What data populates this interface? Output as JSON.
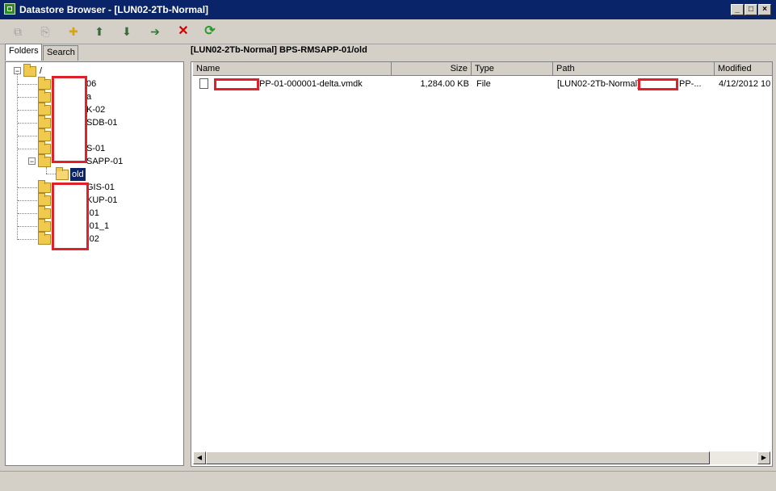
{
  "window": {
    "title": "Datastore Browser - [LUN02-2Tb-Normal]",
    "min": "_",
    "max": "□",
    "close": "×"
  },
  "toolbar": {
    "buttons": [
      {
        "name": "copy-icon",
        "glyph": "⧉",
        "enabled": false
      },
      {
        "name": "paste-icon",
        "glyph": "⎘",
        "enabled": false
      },
      {
        "name": "new-folder-icon",
        "glyph": "✚",
        "enabled": true
      },
      {
        "name": "upload-icon",
        "glyph": "⬆",
        "enabled": true
      },
      {
        "name": "download-icon",
        "glyph": "⬇",
        "enabled": true
      },
      {
        "name": "register-vm-icon",
        "glyph": "➔",
        "enabled": true
      },
      {
        "name": "delete-icon",
        "glyph": "✕",
        "enabled": true
      },
      {
        "name": "refresh-icon",
        "glyph": "⟳",
        "enabled": true
      }
    ]
  },
  "tabs": {
    "folders": "Folders",
    "search": "Search"
  },
  "tree": {
    "root": {
      "label": "/",
      "expander": "−"
    },
    "items": [
      {
        "label": "06",
        "expander": ""
      },
      {
        "label": "a",
        "expander": ""
      },
      {
        "label": "K-02",
        "expander": ""
      },
      {
        "label": "SDB-01",
        "expander": ""
      },
      {
        "label": "",
        "expander": ""
      },
      {
        "label": "S-01",
        "expander": ""
      },
      {
        "label": "SAPP-01",
        "expander": "−"
      },
      {
        "label": "old",
        "expander": "",
        "child": true,
        "selected": true
      },
      {
        "label": "GIS-01",
        "expander": ""
      },
      {
        "label": "KUP-01",
        "expander": ""
      },
      {
        "label": "-01",
        "expander": ""
      },
      {
        "label": "-01_1",
        "expander": ""
      },
      {
        "label": "-02",
        "expander": ""
      }
    ]
  },
  "path": "[LUN02-2Tb-Normal] BPS-RMSAPP-01/old",
  "table": {
    "columns": {
      "name": "Name",
      "size": "Size",
      "type": "Type",
      "path": "Path",
      "modified": "Modified"
    },
    "rows": [
      {
        "name": "PP-01-000001-delta.vmdk",
        "size": "1,284.00 KB",
        "type": "File",
        "path_prefix": "[LUN02-2Tb-Normal]",
        "path_suffix": "PP-...",
        "modified": "4/12/2012 10"
      }
    ]
  },
  "colors": {
    "titlebar": "#0a246a",
    "redaction": "#e0202a",
    "delete": "#d40000",
    "refresh": "#2a9a2a"
  }
}
